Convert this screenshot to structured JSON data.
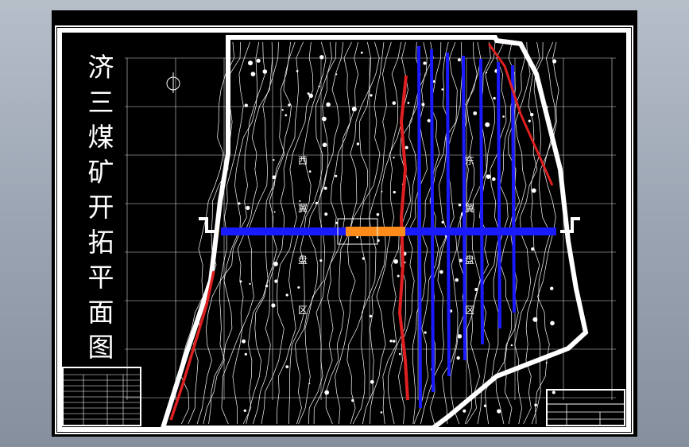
{
  "drawing": {
    "title_chars": [
      "济",
      "三",
      "煤",
      "矿",
      "开",
      "拓",
      "平",
      "面",
      "图"
    ],
    "region_labels": [
      "西",
      "翼",
      "盘",
      "区",
      "东",
      "翼",
      "盘",
      "区"
    ]
  },
  "colors": {
    "frame": "#ffffff",
    "contour": "#ffffff",
    "fault": "#e02020",
    "roadway": "#1a1aff",
    "shaft": "#ff8c1a",
    "background": "#000000"
  }
}
